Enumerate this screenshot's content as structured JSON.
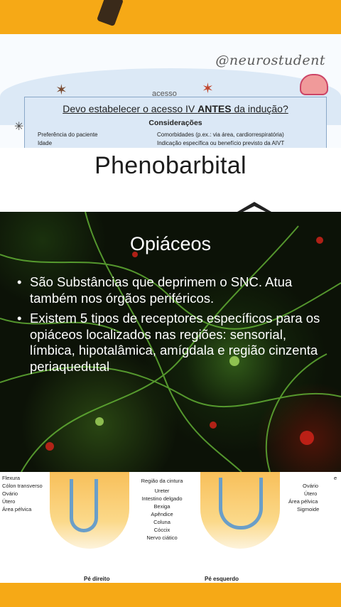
{
  "note": {
    "brand": "@neurostudent",
    "hidden_word": "acesso",
    "question_prefix": "Devo estabelecer o acesso IV ",
    "question_bold": "ANTES",
    "question_suffix": " da indução?",
    "subheading": "Considerações",
    "cells": [
      "Preferência do paciente",
      "Comorbidades (p.ex.: via área, cardiorrespiratória)",
      "Idade",
      "Indicação específica ou benefício previsto da AIVT"
    ]
  },
  "pheno": {
    "title": "Phenobarbital"
  },
  "slide": {
    "title": "Opiáceos",
    "bullets": [
      "São Substâncias que deprimem o SNC. Atua também nos órgãos periféricos.",
      "Existem 5 tipos de receptores específicos para os opiáceos localizados nas regiões: sensorial, límbica, hipotalâmica, amígdala e região cinzenta periaquedutal"
    ]
  },
  "feet": {
    "left_labels": [
      "Flexura",
      "Cólon transverso",
      "Ovário",
      "Útero",
      "Área pélvica"
    ],
    "center_labels": [
      "Região da cintura",
      "Ureter",
      "Intestino delgado",
      "Bexiga",
      "Apêndice",
      "Coluna",
      "Cóccix",
      "Nervo ciático"
    ],
    "right_labels": [
      "e",
      "Ovário",
      "Útero",
      "Área pélvica",
      "Sigmoide"
    ],
    "left_caption": "Pé direito",
    "right_caption": "Pé esquerdo"
  }
}
